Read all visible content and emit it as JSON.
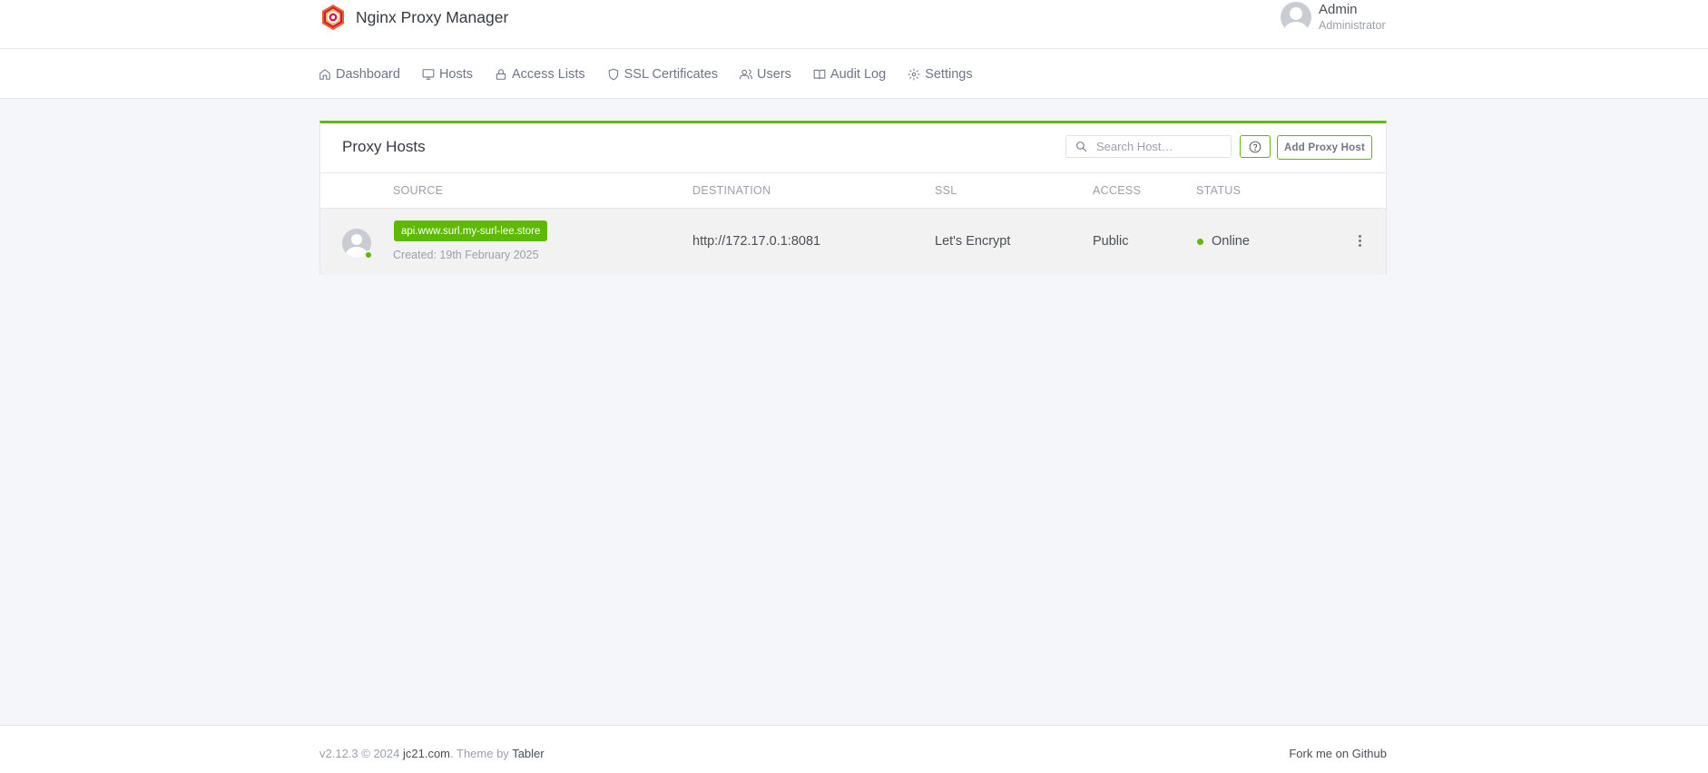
{
  "header": {
    "app_title": "Nginx Proxy Manager",
    "user": {
      "name": "Admin",
      "role": "Administrator"
    }
  },
  "nav": {
    "items": [
      {
        "label": "Dashboard",
        "icon": "home-icon"
      },
      {
        "label": "Hosts",
        "icon": "monitor-icon"
      },
      {
        "label": "Access Lists",
        "icon": "lock-icon"
      },
      {
        "label": "SSL Certificates",
        "icon": "shield-icon"
      },
      {
        "label": "Users",
        "icon": "users-icon"
      },
      {
        "label": "Audit Log",
        "icon": "book-icon"
      },
      {
        "label": "Settings",
        "icon": "gear-icon"
      }
    ]
  },
  "card": {
    "title": "Proxy Hosts",
    "search_placeholder": "Search Host…",
    "add_button": "Add Proxy Host",
    "columns": [
      "SOURCE",
      "DESTINATION",
      "SSL",
      "ACCESS",
      "STATUS"
    ],
    "rows": [
      {
        "source": "api.www.surl.my-surl-lee.store",
        "created": "Created: 19th February 2025",
        "destination": "http://172.17.0.1:8081",
        "ssl": "Let's Encrypt",
        "access": "Public",
        "status": "Online"
      }
    ]
  },
  "footer": {
    "version_prefix": "v2.12.3 © 2024 ",
    "author_link": "jc21.com",
    "theme_text": ". Theme by ",
    "theme_link": "Tabler",
    "github_link": "Fork me on Github"
  },
  "colors": {
    "accent": "#5eba00",
    "background": "#f4f6fa"
  }
}
